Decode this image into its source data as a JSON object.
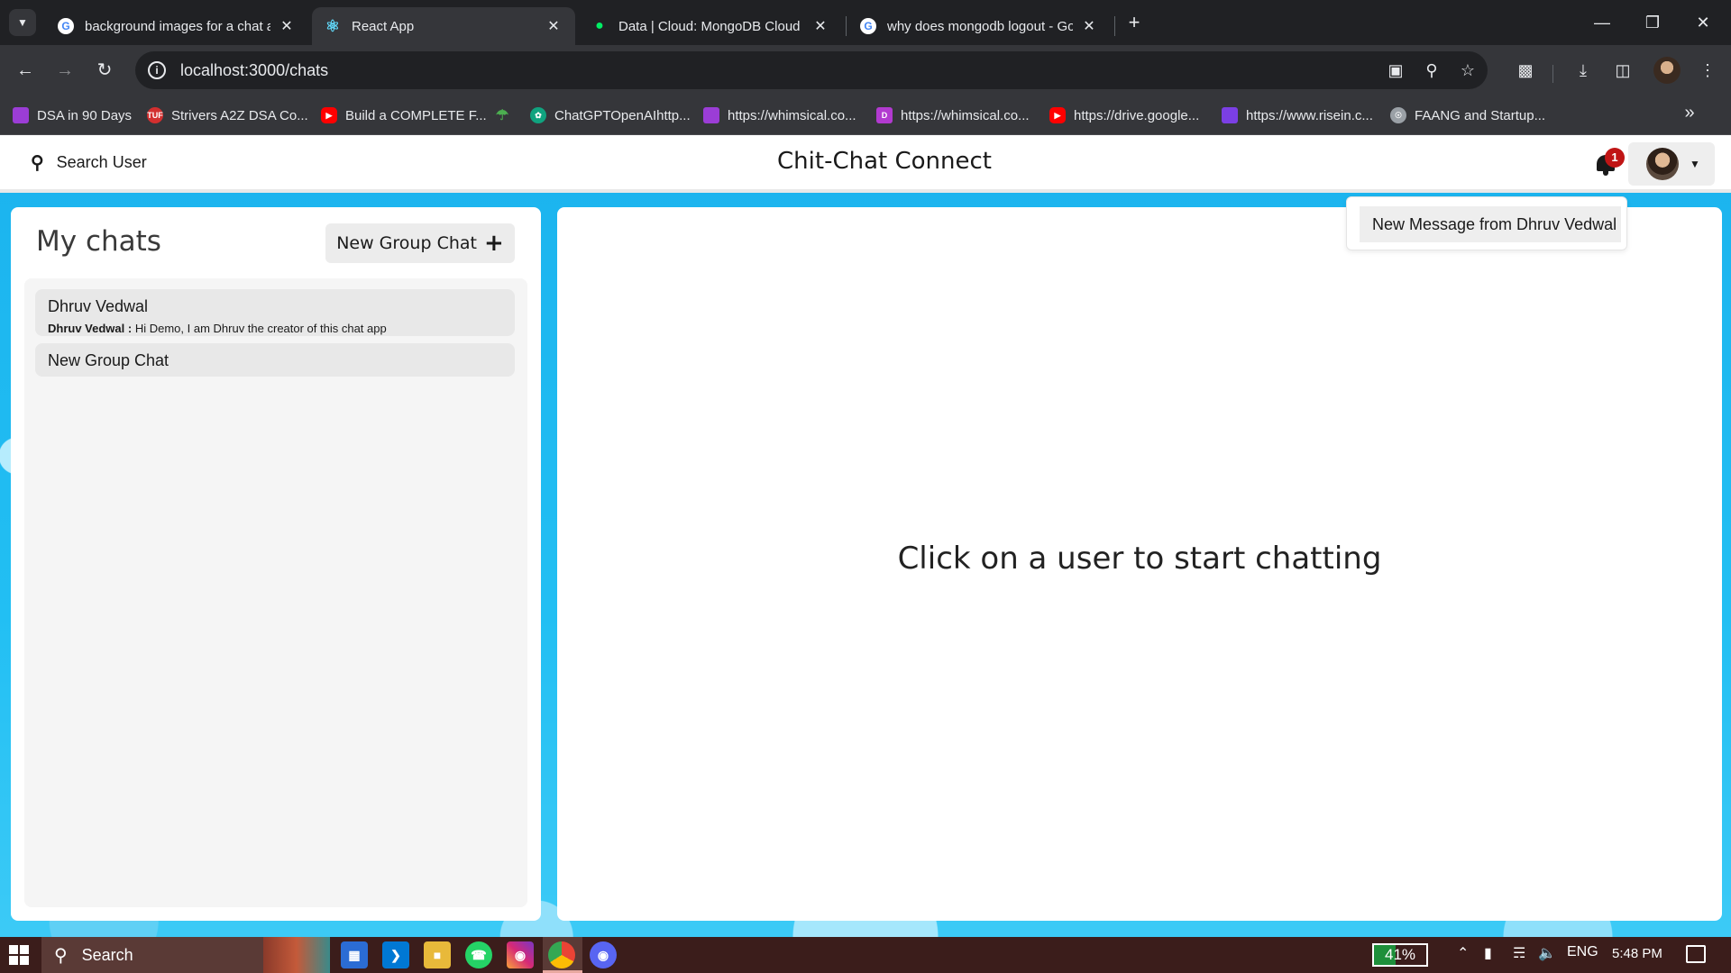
{
  "browser": {
    "tabs": [
      {
        "title": "background images for a chat a",
        "favicon": "google-icon"
      },
      {
        "title": "React App",
        "favicon": "react-icon",
        "active": true
      },
      {
        "title": "Data | Cloud: MongoDB Cloud",
        "favicon": "mongodb-icon"
      },
      {
        "title": "why does mongodb logout - Go",
        "favicon": "google-icon"
      }
    ],
    "url": "localhost:3000/chats",
    "bookmarks": [
      {
        "label": "DSA in 90 Days",
        "color": "#9b3dd6"
      },
      {
        "label": "Strivers A2Z DSA Co...",
        "color": "#d32f2f",
        "badge": "TUF"
      },
      {
        "label": "Build a COMPLETE F...",
        "color": "#ff0000"
      },
      {
        "label": "",
        "color": "#4caf50"
      },
      {
        "label": "ChatGPTOpenAIhttp...",
        "color": "#10a37f"
      },
      {
        "label": "https://whimsical.co...",
        "color": "#9b3dd6"
      },
      {
        "label": "https://whimsical.co...",
        "color": "#b23ad0",
        "badge": "D"
      },
      {
        "label": "https://drive.google...",
        "color": "#ff0000"
      },
      {
        "label": "https://www.risein.c...",
        "color": "#7b3fe4"
      },
      {
        "label": "FAANG and Startup...",
        "color": "#9aa0a6"
      }
    ]
  },
  "app": {
    "search_label": "Search User",
    "title": "Chit-Chat Connect",
    "notification_count": "1",
    "notification_item": "New Message from Dhruv Vedwal",
    "my_chats_title": "My chats",
    "new_group_button": "New Group Chat",
    "chats": [
      {
        "name": "Dhruv Vedwal",
        "latest_sender": "Dhruv Vedwal :",
        "latest_message": "Hi Demo, I am Dhruv the creator of this chat app"
      },
      {
        "name": "New Group Chat"
      }
    ],
    "empty_state": "Click on a user to start chatting"
  },
  "taskbar": {
    "search_label": "Search",
    "battery": "41%",
    "language": "ENG",
    "time": "5:48 PM"
  },
  "colors": {
    "page_background": "#1bb3ee",
    "notification_badge": "#c01515"
  }
}
